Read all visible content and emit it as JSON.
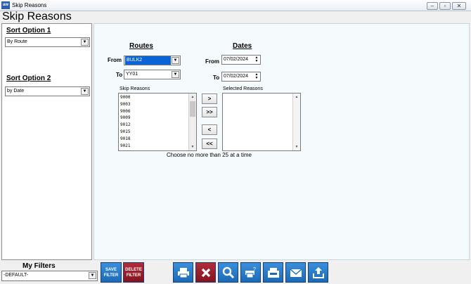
{
  "window": {
    "title": "Skip Reasons",
    "app_icon_text": "aw"
  },
  "page_title": "Skip Reasons",
  "left_panel": {
    "sort_option_1": {
      "label": "Sort Option 1",
      "value": "By Route"
    },
    "sort_option_2": {
      "label": "Sort Option 2",
      "value": "by Date"
    }
  },
  "routes": {
    "heading": "Routes",
    "from_label": "From",
    "from_value": "BULK2",
    "to_label": "To",
    "to_value": "YY01"
  },
  "dates": {
    "heading": "Dates",
    "from_label": "From",
    "from_value": "07/02/2024",
    "to_label": "To",
    "to_value": "07/02/2024"
  },
  "skip_reasons": {
    "label": "Skip Reasons",
    "items": [
      "9000",
      "9003",
      "9006",
      "9009",
      "9012",
      "9015",
      "9018",
      "9021"
    ]
  },
  "selected_reasons": {
    "label": "Selected Reasons",
    "items": []
  },
  "move_buttons": {
    "add_one": ">",
    "add_all": ">>",
    "remove_one": "<",
    "remove_all": "<<"
  },
  "hint": "Choose no more than 25 at a time",
  "filters": {
    "label": "My Filters",
    "value": "-DEFAULT-",
    "save_label_1": "SAVE",
    "save_label_2": "FILTER",
    "delete_label_1": "DELETE",
    "delete_label_2": "FILTER"
  },
  "toolbar": {
    "icons": [
      "print-icon",
      "cancel-icon",
      "preview-icon",
      "print-setup-icon",
      "fax-icon",
      "email-icon",
      "export-icon"
    ]
  },
  "colors": {
    "tool_blue": "#1b6ab8",
    "tool_red": "#86131f",
    "selection": "#0a64d6"
  }
}
